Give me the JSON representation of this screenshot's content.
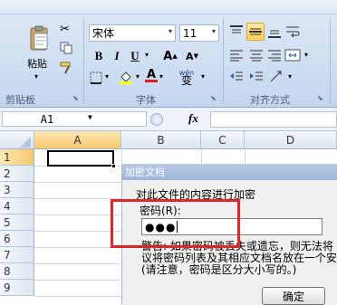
{
  "ribbon": {
    "clipboard": {
      "paste_label": "粘贴",
      "group_label": "剪贴板"
    },
    "font": {
      "font_name": "宋体",
      "font_size": "11",
      "bold": "B",
      "italic": "I",
      "underline": "U",
      "grow": "A",
      "shrink": "A",
      "font_color_glyph": "A",
      "phonetic": "wén",
      "phonetic_char": "变",
      "group_label": "字体"
    },
    "alignment": {
      "group_label": "对齐方式"
    }
  },
  "formula_bar": {
    "name_box": "A1",
    "fx": "fx"
  },
  "sheet": {
    "columns": [
      "A",
      "B",
      "C",
      "D"
    ],
    "rows": [
      "1",
      "2",
      "3",
      "4",
      "5",
      "6",
      "7",
      "8",
      "9"
    ]
  },
  "dialog": {
    "title": "加密文档",
    "prompt": "对此文件的内容进行加密",
    "password_label": "密码(R):",
    "password_value": "●●●",
    "warning_line1": "警告: 如果密码被丢失或遗忘，则无法将",
    "warning_line2": "议将密码列表及其相应文档名放在一个安",
    "warning_line3": "(请注意，密码是区分大小写的。)",
    "ok_label": "确定"
  }
}
